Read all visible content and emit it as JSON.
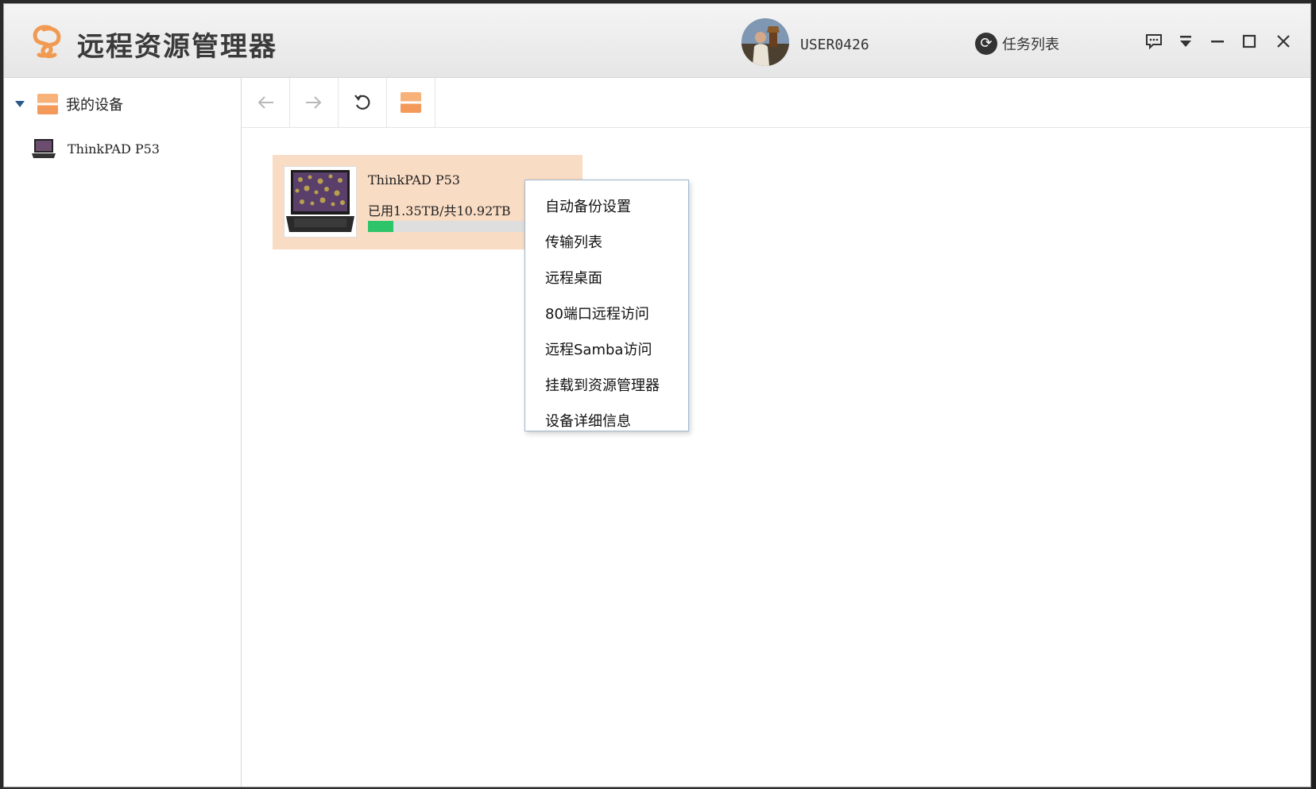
{
  "app": {
    "title": "远程资源管理器",
    "username": "USER0426",
    "task_list_label": "任务列表",
    "brand_color": "#f09a52"
  },
  "window_controls": [
    "feedback-icon",
    "dropdown-menu-icon",
    "minimize-icon",
    "maximize-icon",
    "close-icon"
  ],
  "sidebar": {
    "root_label": "我的设备",
    "items": [
      {
        "label": "ThinkPAD P53"
      }
    ]
  },
  "toolbar": {
    "buttons": [
      "back-arrow-icon",
      "forward-arrow-icon",
      "refresh-icon",
      "device-icon"
    ]
  },
  "device": {
    "name": "ThinkPAD P53",
    "usage_text": "已用1.35TB/共10.92TB",
    "used_fraction": 0.124,
    "card_color": "#f9dcc4",
    "bar_color": "#2ec46a"
  },
  "context_menu": {
    "items": [
      "自动备份设置",
      "传输列表",
      "远程桌面",
      "80端口远程访问",
      "远程Samba访问",
      "挂载到资源管理器",
      "设备详细信息"
    ]
  }
}
